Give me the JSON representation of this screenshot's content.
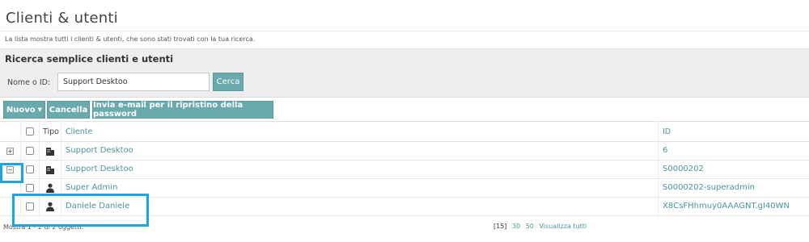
{
  "page": {
    "title": "Clienti & utenti",
    "subtitle": "La lista mostra tutti i clienti & utenti, che sono stati trovati con la tua ricerca."
  },
  "search": {
    "title": "Ricerca semplice clienti e utenti",
    "label": "Nome o ID:",
    "value": "Support Desktoo",
    "button": "Cerca"
  },
  "toolbar": {
    "new_label": "Nuovo",
    "cancel_label": "Cancella",
    "reset_label": "Invia e-mail per il ripristino della password"
  },
  "table": {
    "headers": {
      "type": "Tipo",
      "client": "Cliente",
      "id": "ID"
    },
    "rows": [
      {
        "expander": "+",
        "type": "company-icon",
        "client": "Support Desktoo",
        "id": "6"
      },
      {
        "expander": "−",
        "type": "company-icon",
        "client": "Support Desktoo",
        "id": "S0000202"
      },
      {
        "expander": "",
        "type": "user-icon",
        "client": "Super Admin",
        "id": "S0000202-superadmin"
      },
      {
        "expander": "",
        "type": "user-icon",
        "client": "Daniele Daniele",
        "id": "X8CsFHhmuy0AAAGNT.gI40WN"
      }
    ]
  },
  "footer": {
    "count": "Mostra  1 - 2 di 2 oggetti.",
    "page_current": "[15]",
    "page_30": "30",
    "page_50": "50",
    "show_all": "Visualizza tutti"
  },
  "colors": {
    "accent": "#6aa9ad",
    "link": "#4b9499",
    "highlight": "#1aa4e6"
  }
}
